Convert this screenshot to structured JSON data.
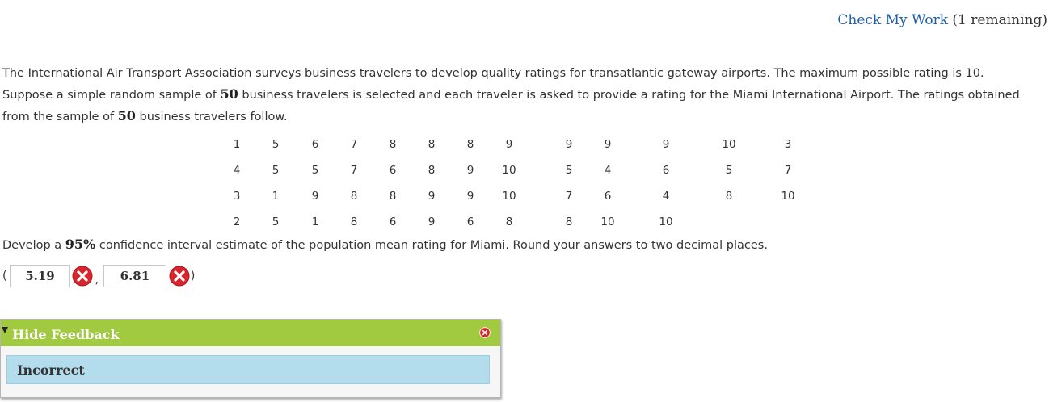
{
  "header": {
    "check_my_work_label": "Check My Work",
    "remaining_label": " (1 remaining)"
  },
  "question": {
    "line1": "The International Air Transport Association surveys business travelers to develop quality ratings for transatlantic gateway airports. The maximum possible rating is 10.",
    "line2_pre": "Suppose a simple random sample of ",
    "line2_num": "50",
    "line2_post": " business travelers is selected and each traveler is asked to provide a rating for the Miami International Airport. The ratings obtained",
    "line3_pre": "from the sample of ",
    "line3_num": "50",
    "line3_post": " business travelers follow."
  },
  "ratings_table": [
    [
      "1",
      "5",
      "6",
      "7",
      "8",
      "8",
      "8",
      "9",
      "9",
      "9",
      "9",
      "10",
      "3"
    ],
    [
      "4",
      "5",
      "5",
      "7",
      "6",
      "8",
      "9",
      "10",
      "5",
      "4",
      "6",
      "5",
      "7"
    ],
    [
      "3",
      "1",
      "9",
      "8",
      "8",
      "9",
      "9",
      "10",
      "7",
      "6",
      "4",
      "8",
      "10"
    ],
    [
      "2",
      "5",
      "1",
      "8",
      "6",
      "9",
      "6",
      "8",
      "8",
      "10",
      "10"
    ]
  ],
  "prompt": {
    "pre": "Develop a ",
    "num": "95%",
    "post": " confidence interval estimate of the population mean rating for Miami. Round your answers to two decimal places."
  },
  "answer": {
    "open_paren": "(",
    "lower_value": "5.19",
    "comma": ",",
    "upper_value": "6.81",
    "close_paren": ")",
    "status": "incorrect",
    "status_icon": "red-x-circle-icon",
    "status_color": "#d9262c"
  },
  "feedback": {
    "toggle_label": "Hide Feedback",
    "message": "Incorrect",
    "header_color": "#a2ca40",
    "body_color": "#b3dced"
  }
}
